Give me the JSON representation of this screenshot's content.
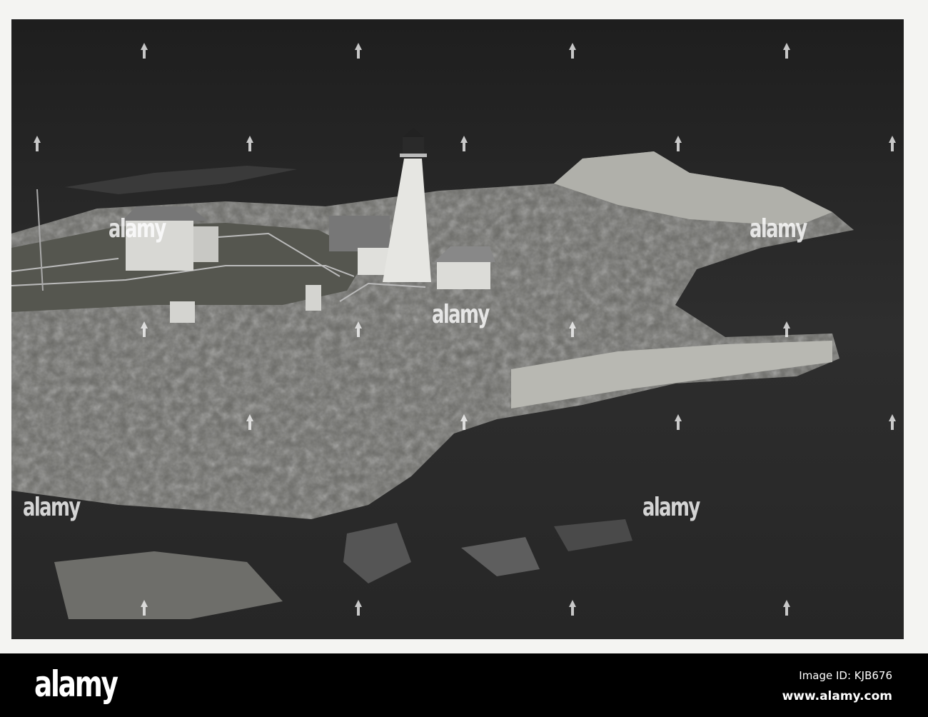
{
  "watermark": {
    "text": "alamy"
  },
  "footer": {
    "logo": "alamy",
    "image_id": "Image ID: KJB676",
    "site": "www.alamy.com"
  }
}
